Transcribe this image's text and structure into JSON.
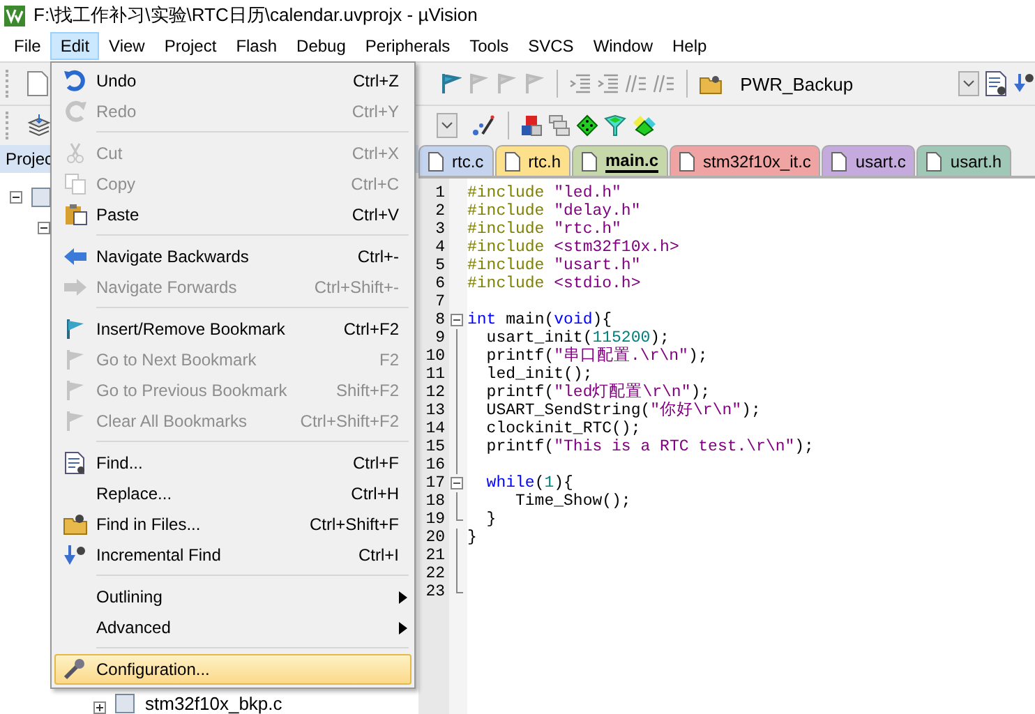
{
  "window": {
    "title": "F:\\找工作补习\\实验\\RTC日历\\calendar.uvprojx - µVision"
  },
  "menubar": [
    {
      "label": "File",
      "selected": false
    },
    {
      "label": "Edit",
      "selected": true
    },
    {
      "label": "View",
      "selected": false
    },
    {
      "label": "Project",
      "selected": false
    },
    {
      "label": "Flash",
      "selected": false
    },
    {
      "label": "Debug",
      "selected": false
    },
    {
      "label": "Peripherals",
      "selected": false
    },
    {
      "label": "Tools",
      "selected": false
    },
    {
      "label": "SVCS",
      "selected": false
    },
    {
      "label": "Window",
      "selected": false
    },
    {
      "label": "Help",
      "selected": false
    }
  ],
  "toolbar": {
    "target": "PWR_Backup"
  },
  "project_panel": {
    "title": "Projec",
    "tree": [
      {
        "expanded": true,
        "children": [
          {
            "expanded": true,
            "children": [
              {
                "children": [
                  {
                    "label": "stm32f10x_bkp.c",
                    "expanded": false
                  }
                ]
              }
            ]
          }
        ]
      }
    ]
  },
  "tabs": [
    {
      "label": "rtc.c",
      "color": "#c5d4ee",
      "selected": false
    },
    {
      "label": "rtc.h",
      "color": "#fde08c",
      "selected": false
    },
    {
      "label": "main.c",
      "color": "#c6d7a9",
      "selected": true
    },
    {
      "label": "stm32f10x_it.c",
      "color": "#f0a3a3",
      "selected": false
    },
    {
      "label": "usart.c",
      "color": "#c4aadd",
      "selected": false
    },
    {
      "label": "usart.h",
      "color": "#9fc9b6",
      "selected": false
    }
  ],
  "editor": {
    "lines": [
      {
        "number": "1",
        "segments": [
          {
            "kind": "pp",
            "text": "#include "
          },
          {
            "kind": "str",
            "text": "\"led.h\""
          }
        ]
      },
      {
        "number": "2",
        "segments": [
          {
            "kind": "pp",
            "text": "#include "
          },
          {
            "kind": "str",
            "text": "\"delay.h\""
          }
        ]
      },
      {
        "number": "3",
        "segments": [
          {
            "kind": "pp",
            "text": "#include "
          },
          {
            "kind": "str",
            "text": "\"rtc.h\""
          }
        ]
      },
      {
        "number": "4",
        "segments": [
          {
            "kind": "pp",
            "text": "#include "
          },
          {
            "kind": "str",
            "text": "<stm32f10x.h>"
          }
        ]
      },
      {
        "number": "5",
        "segments": [
          {
            "kind": "pp",
            "text": "#include "
          },
          {
            "kind": "str",
            "text": "\"usart.h\""
          }
        ]
      },
      {
        "number": "6",
        "segments": [
          {
            "kind": "pp",
            "text": "#include "
          },
          {
            "kind": "str",
            "text": "<stdio.h>"
          }
        ]
      },
      {
        "number": "7"
      },
      {
        "number": "8",
        "expanded": true,
        "segments": [
          {
            "kind": "kw",
            "text": "int"
          },
          {
            "kind": "plain",
            "text": " main("
          },
          {
            "kind": "kw",
            "text": "void"
          },
          {
            "kind": "plain",
            "text": "){"
          }
        ],
        "children": [
          {
            "number": "9",
            "segments": [
              {
                "kind": "plain",
                "text": "  usart_init("
              },
              {
                "kind": "num",
                "text": "115200"
              },
              {
                "kind": "plain",
                "text": ");"
              }
            ]
          },
          {
            "number": "10",
            "segments": [
              {
                "kind": "plain",
                "text": "  printf("
              },
              {
                "kind": "str",
                "text": "\"串口配置.\\r\\n\""
              },
              {
                "kind": "plain",
                "text": ");"
              }
            ]
          },
          {
            "number": "11",
            "segments": [
              {
                "kind": "plain",
                "text": "  led_init();"
              }
            ]
          },
          {
            "number": "12",
            "segments": [
              {
                "kind": "plain",
                "text": "  printf("
              },
              {
                "kind": "str",
                "text": "\"led灯配置\\r\\n\""
              },
              {
                "kind": "plain",
                "text": ");"
              }
            ]
          },
          {
            "number": "13",
            "segments": [
              {
                "kind": "plain",
                "text": "  USART_SendString("
              },
              {
                "kind": "str",
                "text": "\"你好\\r\\n\""
              },
              {
                "kind": "plain",
                "text": ");"
              }
            ]
          },
          {
            "number": "14",
            "segments": [
              {
                "kind": "plain",
                "text": "  clockinit_RTC();"
              }
            ]
          },
          {
            "number": "15",
            "segments": [
              {
                "kind": "plain",
                "text": "  printf("
              },
              {
                "kind": "str",
                "text": "\"This is a RTC test.\\r\\n\""
              },
              {
                "kind": "plain",
                "text": ");"
              }
            ]
          },
          {
            "number": "16"
          },
          {
            "number": "17",
            "expanded": true,
            "segments": [
              {
                "kind": "kw",
                "text": "  while"
              },
              {
                "kind": "plain",
                "text": "("
              },
              {
                "kind": "num",
                "text": "1"
              },
              {
                "kind": "plain",
                "text": "){"
              }
            ],
            "children": [
              {
                "number": "18",
                "segments": [
                  {
                    "kind": "plain",
                    "text": "     Time_Show();"
                  }
                ]
              },
              {
                "number": "19",
                "segments": [
                  {
                    "kind": "plain",
                    "text": "  }"
                  }
                ]
              }
            ]
          },
          {
            "number": "20",
            "segments": [
              {
                "kind": "plain",
                "text": "}"
              }
            ]
          },
          {
            "number": "21"
          },
          {
            "number": "22"
          },
          {
            "number": "23"
          }
        ]
      }
    ]
  },
  "edit_menu": [
    {
      "kind": "item",
      "label": "Undo",
      "shortcut": "Ctrl+Z",
      "disabled": false,
      "selected": false
    },
    {
      "kind": "item",
      "label": "Redo",
      "shortcut": "Ctrl+Y",
      "disabled": true,
      "selected": false
    },
    {
      "kind": "separator"
    },
    {
      "kind": "item",
      "label": "Cut",
      "shortcut": "Ctrl+X",
      "disabled": true,
      "selected": false
    },
    {
      "kind": "item",
      "label": "Copy",
      "shortcut": "Ctrl+C",
      "disabled": true,
      "selected": false
    },
    {
      "kind": "item",
      "label": "Paste",
      "shortcut": "Ctrl+V",
      "disabled": false,
      "selected": false
    },
    {
      "kind": "separator"
    },
    {
      "kind": "item",
      "label": "Navigate Backwards",
      "shortcut": "Ctrl+-",
      "disabled": false,
      "selected": false
    },
    {
      "kind": "item",
      "label": "Navigate Forwards",
      "shortcut": "Ctrl+Shift+-",
      "disabled": true,
      "selected": false
    },
    {
      "kind": "separator"
    },
    {
      "kind": "item",
      "label": "Insert/Remove Bookmark",
      "shortcut": "Ctrl+F2",
      "disabled": false,
      "selected": false
    },
    {
      "kind": "item",
      "label": "Go to Next Bookmark",
      "shortcut": "F2",
      "disabled": true,
      "selected": false
    },
    {
      "kind": "item",
      "label": "Go to Previous Bookmark",
      "shortcut": "Shift+F2",
      "disabled": true,
      "selected": false
    },
    {
      "kind": "item",
      "label": "Clear All Bookmarks",
      "shortcut": "Ctrl+Shift+F2",
      "disabled": true,
      "selected": false
    },
    {
      "kind": "separator"
    },
    {
      "kind": "item",
      "label": "Find...",
      "shortcut": "Ctrl+F",
      "disabled": false,
      "selected": false
    },
    {
      "kind": "item",
      "label": "Replace...",
      "shortcut": "Ctrl+H",
      "disabled": false,
      "selected": false
    },
    {
      "kind": "item",
      "label": "Find in Files...",
      "shortcut": "Ctrl+Shift+F",
      "disabled": false,
      "selected": false
    },
    {
      "kind": "item",
      "label": "Incremental Find",
      "shortcut": "Ctrl+I",
      "disabled": false,
      "selected": false
    },
    {
      "kind": "separator"
    },
    {
      "kind": "submenu",
      "label": "Outlining",
      "disabled": false,
      "selected": false
    },
    {
      "kind": "submenu",
      "label": "Advanced",
      "disabled": false,
      "selected": false
    },
    {
      "kind": "separator"
    },
    {
      "kind": "item",
      "label": "Configuration...",
      "disabled": false,
      "selected": true
    }
  ]
}
